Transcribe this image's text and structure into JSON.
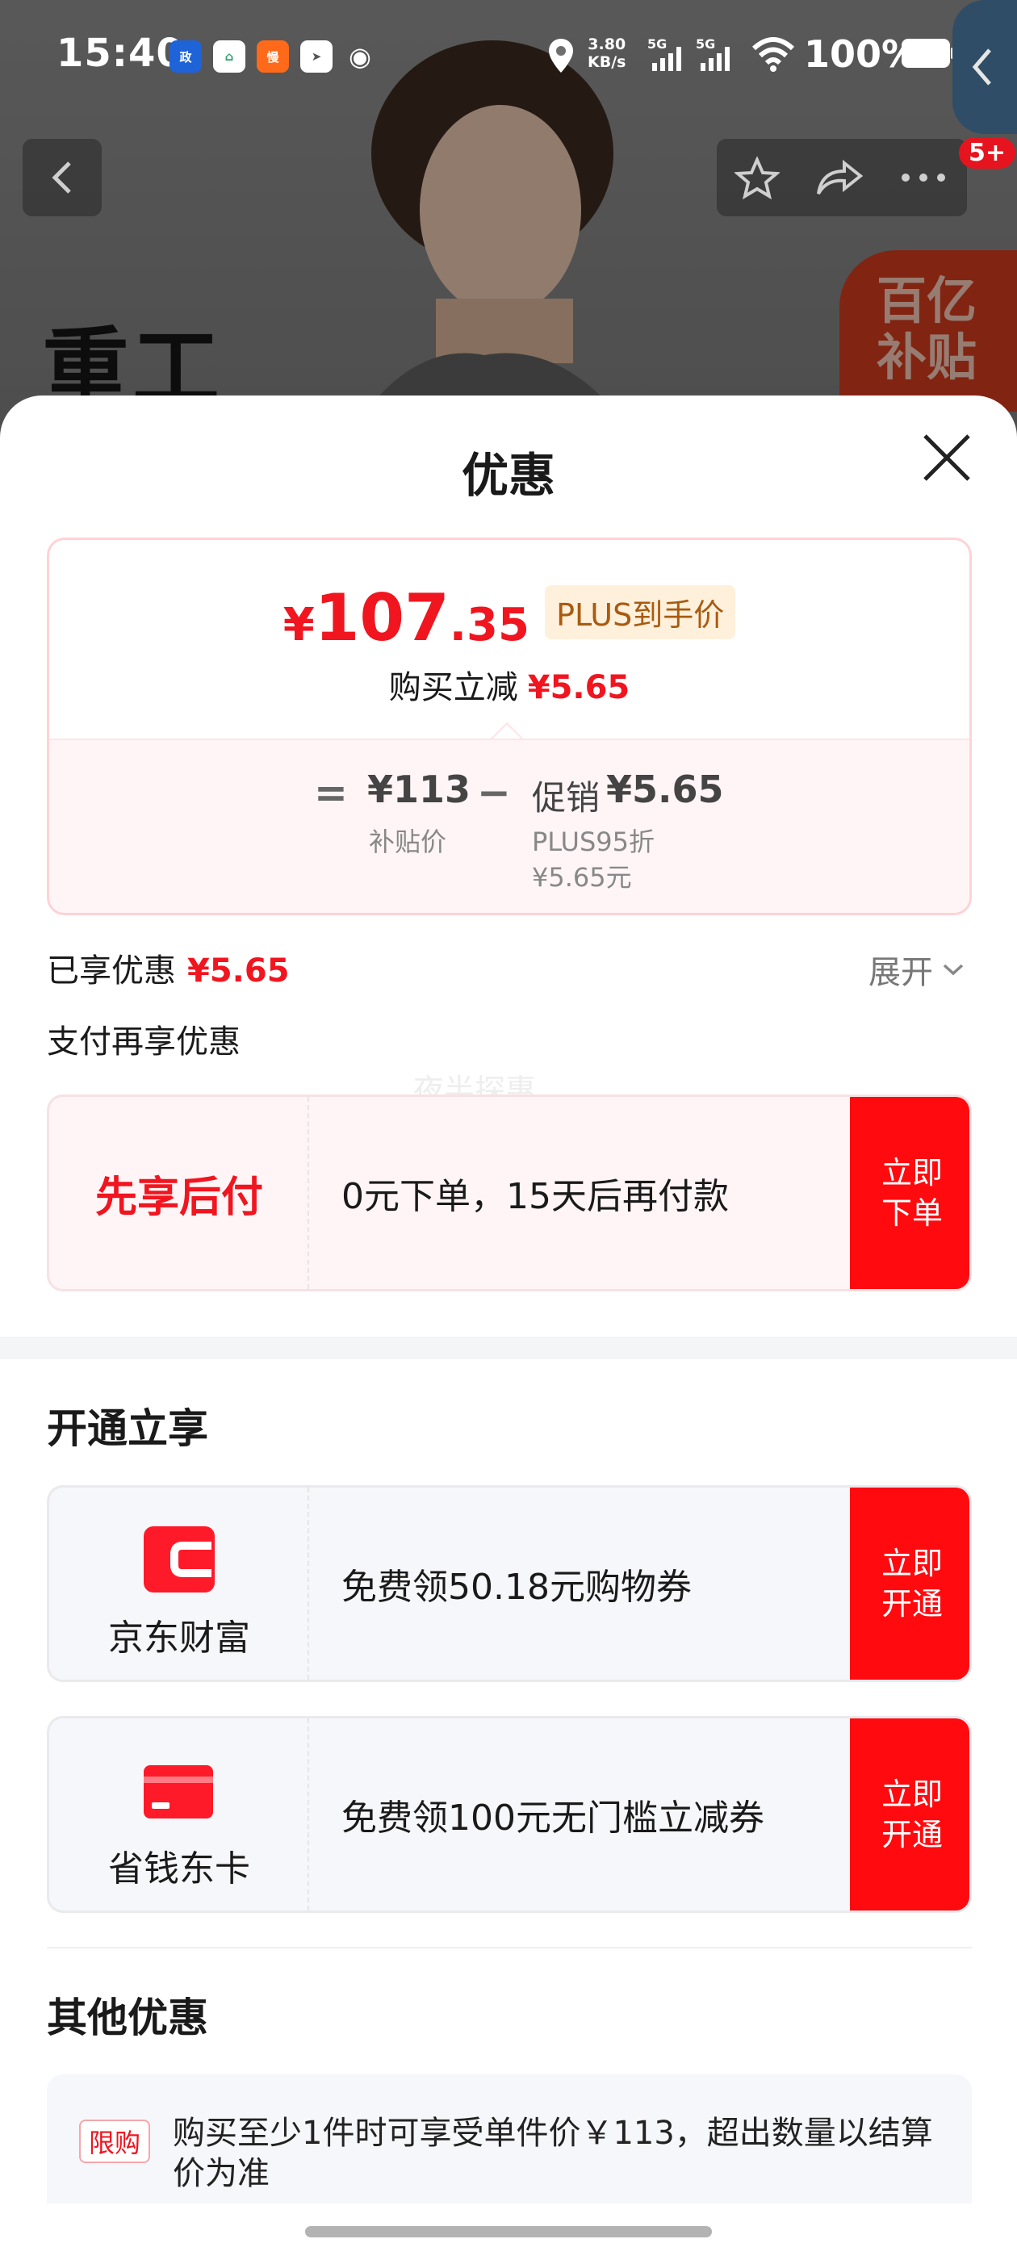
{
  "status_bar": {
    "time": "15:40",
    "net_speed_value": "3.80",
    "net_speed_unit": "KB/s",
    "battery": "100%",
    "apps": [
      "政态",
      "政务",
      "慢",
      "send",
      "wechat"
    ]
  },
  "background": {
    "product_title": "重工",
    "badge": "百亿补贴",
    "cart_count": "5+"
  },
  "sheet": {
    "title": "优惠",
    "price": {
      "currency": "¥",
      "integer": "107",
      "decimal": ".35",
      "plus_label": "PLUS到手价",
      "reduce_label": "购买立减",
      "reduce_amount": "¥5.65"
    },
    "formula": {
      "equals": "=",
      "base_price": "¥113",
      "base_label": "补贴价",
      "minus": "−",
      "promo_label": "促销",
      "promo_amount": "¥5.65",
      "promo_detail_line1": "PLUS95折",
      "promo_detail_line2": "¥5.65元"
    },
    "enjoyed": {
      "label": "已享优惠",
      "amount": "¥5.65",
      "expand_label": "展开"
    },
    "pay_more_label": "支付再享优惠",
    "watermark": "夜半探惠",
    "pay_later": {
      "name": "先享后付",
      "description": "0元下单，15天后再付款",
      "button": [
        "立即",
        "下单"
      ]
    },
    "open_section_title": "开通立享",
    "open_offers": [
      {
        "brand": "京东财富",
        "description": "免费领50.18元购物券",
        "button": [
          "立即",
          "开通"
        ]
      },
      {
        "brand": "省钱东卡",
        "description": "免费领100元无门槛立减券",
        "button": [
          "立即",
          "开通"
        ]
      }
    ],
    "other_section_title": "其他优惠",
    "other_offer": {
      "tag": "限购",
      "text": "购买至少1件时可享受单件价￥113，超出数量以结算价为准"
    }
  },
  "colors": {
    "accent_red": "#f0151f",
    "button_red": "#ff0a0f",
    "plus_tag_bg": "#fff0db",
    "plus_tag_text": "#a85b10"
  }
}
